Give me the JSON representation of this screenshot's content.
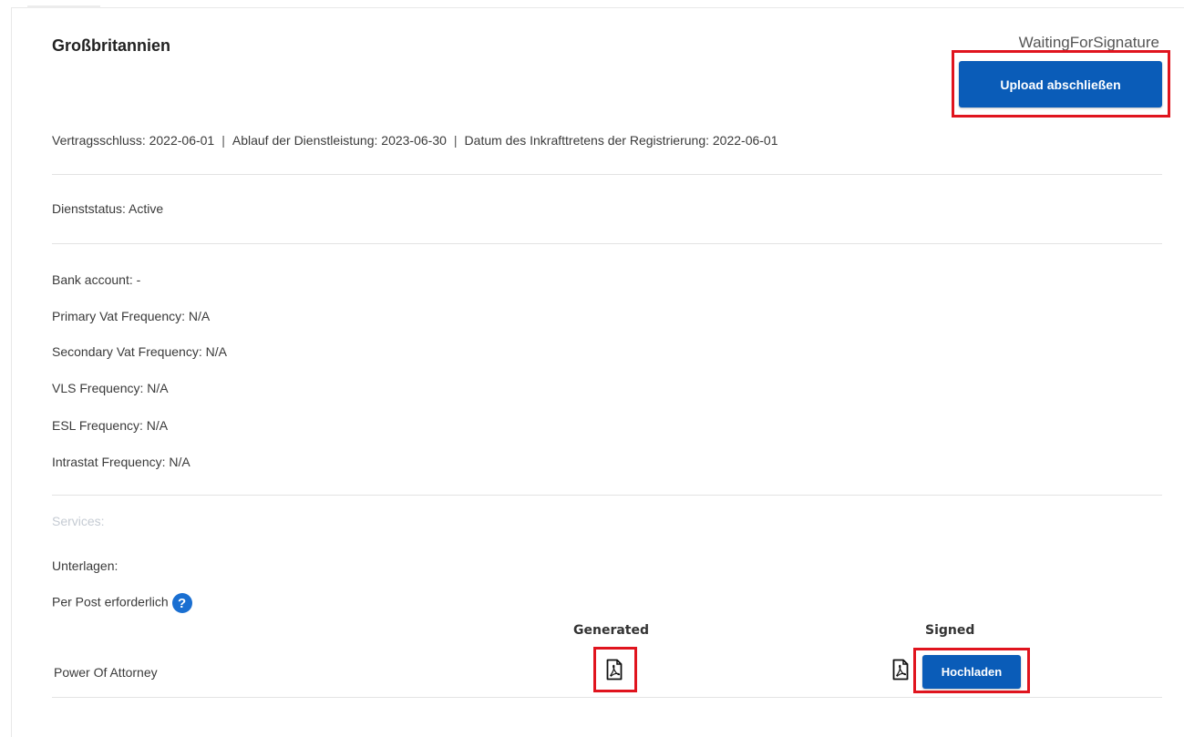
{
  "header": {
    "country": "Großbritannien",
    "status": "WaitingForSignature",
    "upload_complete_label": "Upload abschließen"
  },
  "dates": {
    "contract": "Vertragsschluss: 2022-06-01",
    "expiry": "Ablauf der Dienstleistung: 2023-06-30",
    "registration": "Datum des Inkrafttretens der Registrierung: 2022-06-01",
    "separator": "|"
  },
  "service_status": "Dienststatus: Active",
  "details": {
    "bank_account": "Bank account: -",
    "primary_vat": "Primary Vat Frequency: N/A",
    "secondary_vat": "Secondary Vat Frequency: N/A",
    "vls": "VLS Frequency: N/A",
    "esl": "ESL Frequency: N/A",
    "intrastat": "Intrastat Frequency: N/A"
  },
  "services_label": "Services:",
  "documents": {
    "label": "Unterlagen:",
    "by_post": "Per Post erforderlich",
    "help_glyph": "?",
    "col_generated": "Generated",
    "col_signed": "Signed",
    "rows": [
      {
        "name": "Power Of Attorney",
        "upload_label": "Hochladen"
      }
    ]
  },
  "icons": {
    "generated_pdf": "pdf-file-icon",
    "signed_pdf": "pdf-file-icon",
    "help": "question-circle-icon"
  },
  "colors": {
    "primary": "#0a5cb8",
    "highlight": "#e0141e",
    "help_icon": "#1a6fd1",
    "muted_text": "#c5cbd3"
  }
}
